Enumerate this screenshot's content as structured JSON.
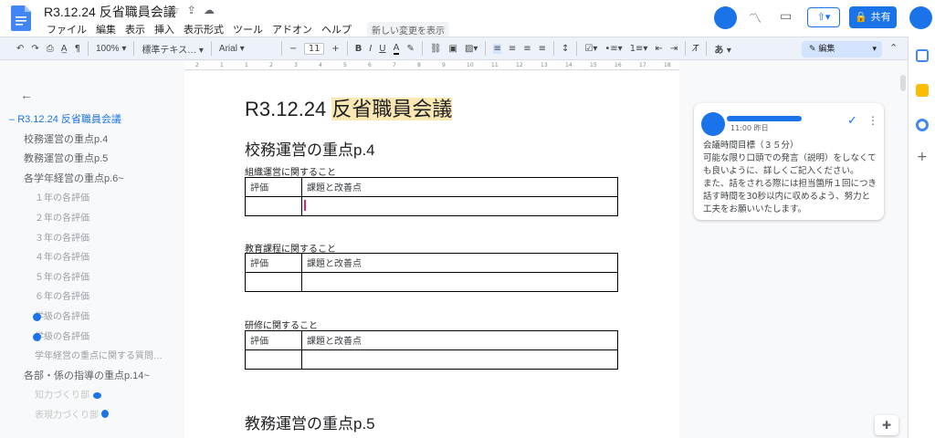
{
  "title": "R3.12.24 反省職員会議",
  "title_icons": [
    "☆",
    "⇪",
    "☁"
  ],
  "menu": [
    "ファイル",
    "編集",
    "表示",
    "挿入",
    "表示形式",
    "ツール",
    "アドオン",
    "ヘルプ"
  ],
  "changes_label": "新しい変更を表示",
  "share_label": "共有",
  "toolbar": {
    "zoom": "100%",
    "style": "標準テキス…",
    "font": "Arial",
    "font_size": "11",
    "mode": "編集"
  },
  "ruler_marks": [
    "2",
    "1",
    "1",
    "2",
    "3",
    "4",
    "5",
    "6",
    "7",
    "8",
    "9",
    "10",
    "11",
    "12",
    "13",
    "14",
    "15",
    "16",
    "17",
    "18"
  ],
  "outline": [
    {
      "label": "R3.12.24 反省職員会議",
      "level": 0,
      "active": true
    },
    {
      "label": "校務運営の重点p.4",
      "level": 1
    },
    {
      "label": "教務運営の重点p.5",
      "level": 1
    },
    {
      "label": "各学年経営の重点p.6~",
      "level": 1
    },
    {
      "label": "１年の各評価",
      "level": 2
    },
    {
      "label": "２年の各評価",
      "level": 2
    },
    {
      "label": "３年の各評価",
      "level": 2
    },
    {
      "label": "４年の各評価",
      "level": 2
    },
    {
      "label": "５年の各評価",
      "level": 2
    },
    {
      "label": "６年の各評価",
      "level": 2
    },
    {
      "label": "学級の各評価",
      "level": 2
    },
    {
      "label": "学級の各評価",
      "level": 2
    },
    {
      "label": "学年経営の重点に関する質問…",
      "level": 2
    },
    {
      "label": "各部・係の指導の重点p.14~",
      "level": 1
    },
    {
      "label": "知力づくり部",
      "level": 2
    },
    {
      "label": "表現力づくり部",
      "level": 2
    }
  ],
  "document": {
    "title_prefix": "R3.12.24",
    "title_highlight": "反省職員会議",
    "heading1": "校務運営の重点p.4",
    "sections": [
      {
        "label": "組織運営に関すること",
        "col1": "評価",
        "col2": "課題と改善点"
      },
      {
        "label": "教育課程に関すること",
        "col1": "評価",
        "col2": "課題と改善点"
      },
      {
        "label": "研修に関すること",
        "col1": "評価",
        "col2": "課題と改善点"
      }
    ],
    "heading2": "教務運営の重点p.5"
  },
  "comment": {
    "time": "11:00 昨日",
    "body": "会議時間目標（３５分）\n可能な限り口頭での発言（説明）をしなくても良いように、詳しくご記入ください。\nまた、話をされる際には担当箇所１回につき話す時間を30秒以内に収めるよう、努力と工夫をお願いいたします。"
  },
  "colors": {
    "accent": "#1a73e8",
    "highlight": "#fce8b2"
  }
}
